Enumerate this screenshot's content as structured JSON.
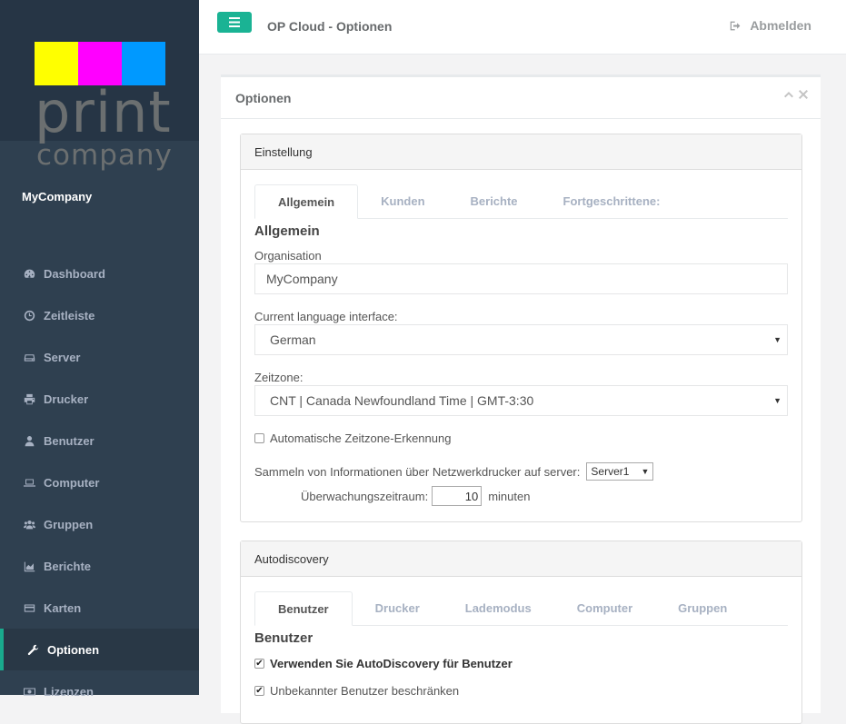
{
  "brand": {
    "logo_colors": [
      "#ffff00",
      "#ff00ff",
      "#0099ff"
    ],
    "logo_text_1": "print",
    "logo_text_2": "company",
    "company_name": "MyCompany"
  },
  "nav": {
    "items": [
      {
        "label": "Dashboard",
        "icon": "dashboard-icon"
      },
      {
        "label": "Zeitleiste",
        "icon": "clock-icon"
      },
      {
        "label": "Server",
        "icon": "server-icon"
      },
      {
        "label": "Drucker",
        "icon": "printer-icon"
      },
      {
        "label": "Benutzer",
        "icon": "user-icon"
      },
      {
        "label": "Computer",
        "icon": "laptop-icon"
      },
      {
        "label": "Gruppen",
        "icon": "users-icon"
      },
      {
        "label": "Berichte",
        "icon": "area-chart-icon"
      },
      {
        "label": "Karten",
        "icon": "credit-card-icon"
      },
      {
        "label": "Optionen",
        "icon": "wrench-icon",
        "active": true
      },
      {
        "label": "Lizenzen",
        "icon": "money-icon"
      }
    ]
  },
  "topbar": {
    "title": "OP Cloud - Optionen",
    "logout_label": "Abmelden"
  },
  "ibox": {
    "title": "Optionen"
  },
  "settings": {
    "heading": "Einstellung",
    "tabs": [
      "Allgemein",
      "Kunden",
      "Berichte",
      "Fortgeschrittene:"
    ],
    "active_tab": "Allgemein",
    "section_title": "Allgemein",
    "organisation_label": "Organisation",
    "organisation_value": "MyCompany",
    "language_label": "Current language interface:",
    "language_value": "German",
    "timezone_label": "Zeitzone:",
    "timezone_value": "CNT | Canada Newfoundland Time | GMT-3:30",
    "auto_tz_label": "Automatische Zeitzone-Erkennung",
    "auto_tz_checked": false,
    "collect_label": "Sammeln von Informationen über Netzwerkdrucker auf server:",
    "collect_server": "Server1",
    "monitor_label": "Überwachungszeitraum:",
    "monitor_value": "10",
    "monitor_unit": "minuten"
  },
  "autodiscovery": {
    "heading": "Autodiscovery",
    "tabs": [
      "Benutzer",
      "Drucker",
      "Lademodus",
      "Computer",
      "Gruppen"
    ],
    "active_tab": "Benutzer",
    "section_title": "Benutzer",
    "use_label": "Verwenden Sie AutoDiscovery für Benutzer",
    "use_checked": true,
    "restrict_label": "Unbekannter Benutzer beschränken",
    "restrict_checked": true
  },
  "colors": {
    "sidebar": "#2f4050",
    "accent": "#1ab394"
  }
}
